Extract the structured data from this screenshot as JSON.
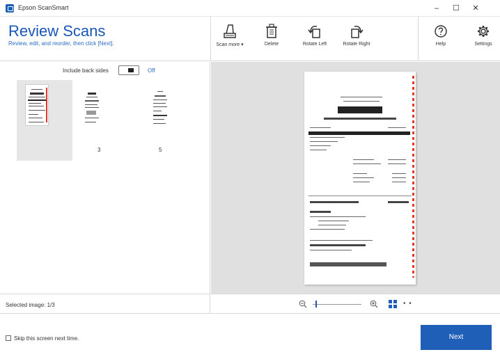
{
  "window": {
    "title": "Epson ScanSmart",
    "minimize": "–",
    "maximize": "☐",
    "close": "✕"
  },
  "header": {
    "title": "Review Scans",
    "subtitle": "Review, edit, and reorder, then click [Next]."
  },
  "toolbar": {
    "scan_more": "Scan more ▾",
    "delete": "Delete",
    "rotate_left": "Rotate Left",
    "rotate_right": "Rotate Right",
    "help": "Help",
    "settings": "Settings"
  },
  "left_panel": {
    "back_sides_label": "Include back sides",
    "back_sides_state": "Off",
    "thumbnails": [
      {
        "number": "",
        "selected": true
      },
      {
        "number": "3",
        "selected": false
      },
      {
        "number": "5",
        "selected": false
      }
    ]
  },
  "status": {
    "selected_image": "Selected image: 1/3"
  },
  "zoom": {
    "more_label": "• •"
  },
  "footer": {
    "skip_label": "Skip this screen next time.",
    "next_label": "Next"
  },
  "colors": {
    "accent": "#1f5fb8",
    "title_blue": "#1a56b8",
    "receipt_red": "#e03a2a",
    "preview_bg": "#e0e0e0"
  }
}
